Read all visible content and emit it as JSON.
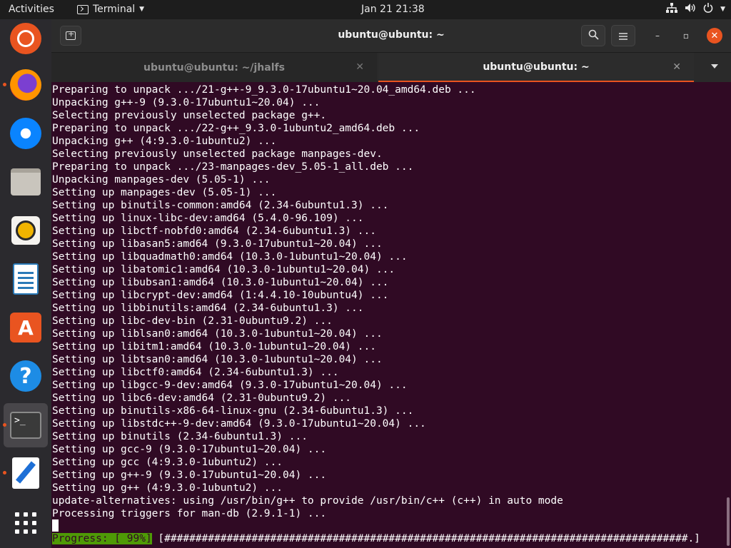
{
  "topbar": {
    "activities": "Activities",
    "app_name": "Terminal",
    "clock": "Jan 21  21:38"
  },
  "dock": {
    "items": [
      {
        "name": "ubuntu-installer",
        "icon": "ubuntu-icon"
      },
      {
        "name": "firefox",
        "icon": "firefox-icon"
      },
      {
        "name": "thunderbird",
        "icon": "thunderbird-icon"
      },
      {
        "name": "files",
        "icon": "files-icon"
      },
      {
        "name": "rhythmbox",
        "icon": "rhythmbox-icon"
      },
      {
        "name": "libreoffice-writer",
        "icon": "writer-icon"
      },
      {
        "name": "software",
        "icon": "app-store-icon"
      },
      {
        "name": "help",
        "icon": "help-icon"
      },
      {
        "name": "terminal",
        "icon": "terminal-icon"
      },
      {
        "name": "text-editor",
        "icon": "text-editor-icon"
      },
      {
        "name": "show-applications",
        "icon": "app-grid-icon"
      }
    ],
    "accent_color": "#e95420"
  },
  "window": {
    "title": "ubuntu@ubuntu: ~",
    "tabs": [
      {
        "label": "ubuntu@ubuntu: ~/jhalfs",
        "active": false
      },
      {
        "label": "ubuntu@ubuntu: ~",
        "active": true
      }
    ]
  },
  "terminal": {
    "background": "#300a24",
    "lines": [
      "Preparing to unpack .../21-g++-9_9.3.0-17ubuntu1~20.04_amd64.deb ...",
      "Unpacking g++-9 (9.3.0-17ubuntu1~20.04) ...",
      "Selecting previously unselected package g++.",
      "Preparing to unpack .../22-g++_9.3.0-1ubuntu2_amd64.deb ...",
      "Unpacking g++ (4:9.3.0-1ubuntu2) ...",
      "Selecting previously unselected package manpages-dev.",
      "Preparing to unpack .../23-manpages-dev_5.05-1_all.deb ...",
      "Unpacking manpages-dev (5.05-1) ...",
      "Setting up manpages-dev (5.05-1) ...",
      "Setting up binutils-common:amd64 (2.34-6ubuntu1.3) ...",
      "Setting up linux-libc-dev:amd64 (5.4.0-96.109) ...",
      "Setting up libctf-nobfd0:amd64 (2.34-6ubuntu1.3) ...",
      "Setting up libasan5:amd64 (9.3.0-17ubuntu1~20.04) ...",
      "Setting up libquadmath0:amd64 (10.3.0-1ubuntu1~20.04) ...",
      "Setting up libatomic1:amd64 (10.3.0-1ubuntu1~20.04) ...",
      "Setting up libubsan1:amd64 (10.3.0-1ubuntu1~20.04) ...",
      "Setting up libcrypt-dev:amd64 (1:4.4.10-10ubuntu4) ...",
      "Setting up libbinutils:amd64 (2.34-6ubuntu1.3) ...",
      "Setting up libc-dev-bin (2.31-0ubuntu9.2) ...",
      "Setting up liblsan0:amd64 (10.3.0-1ubuntu1~20.04) ...",
      "Setting up libitm1:amd64 (10.3.0-1ubuntu1~20.04) ...",
      "Setting up libtsan0:amd64 (10.3.0-1ubuntu1~20.04) ...",
      "Setting up libctf0:amd64 (2.34-6ubuntu1.3) ...",
      "Setting up libgcc-9-dev:amd64 (9.3.0-17ubuntu1~20.04) ...",
      "Setting up libc6-dev:amd64 (2.31-0ubuntu9.2) ...",
      "Setting up binutils-x86-64-linux-gnu (2.34-6ubuntu1.3) ...",
      "Setting up libstdc++-9-dev:amd64 (9.3.0-17ubuntu1~20.04) ...",
      "Setting up binutils (2.34-6ubuntu1.3) ...",
      "Setting up gcc-9 (9.3.0-17ubuntu1~20.04) ...",
      "Setting up gcc (4:9.3.0-1ubuntu2) ...",
      "Setting up g++-9 (9.3.0-17ubuntu1~20.04) ...",
      "Setting up g++ (4:9.3.0-1ubuntu2) ...",
      "update-alternatives: using /usr/bin/g++ to provide /usr/bin/c++ (c++) in auto mode",
      "Processing triggers for man-db (2.9.1-1) ..."
    ],
    "progress": {
      "label": "Progress: [ 99%]",
      "bar": " [####################################################################################.]",
      "percent": 99,
      "label_color": "#4e9a06"
    }
  }
}
